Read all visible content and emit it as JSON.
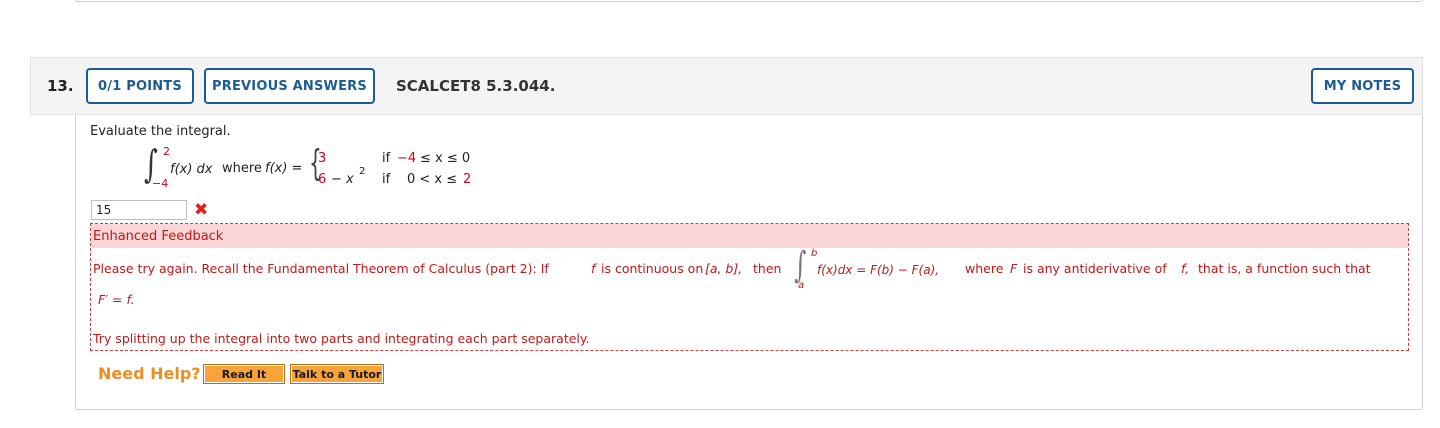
{
  "question": {
    "number": "13.",
    "points_label": "0/1 POINTS",
    "previous_answers_label": "PREVIOUS ANSWERS",
    "reference": "SCALCET8 5.3.044.",
    "my_notes_label": "MY NOTES",
    "prompt": "Evaluate the integral."
  },
  "math": {
    "upper_limit": "2",
    "lower_limit": "−4",
    "integrand": "f(x) dx",
    "where_text": "where",
    "fx_eq": "f(x) =",
    "case1_value": "3",
    "case1_if": "if",
    "case1_cond_lo": "−4",
    "case1_cond_rest": "≤ x ≤ 0",
    "case2_value_a": "6",
    "case2_value_b": "− x",
    "case2_exp": "2",
    "case2_if": "if",
    "case2_cond_lo": "0 < x ≤",
    "case2_cond_hi": "2"
  },
  "answer": {
    "value": "15",
    "status_icon": "x-mark-icon",
    "status_glyph": "✖"
  },
  "feedback": {
    "title": "Enhanced Feedback",
    "line1_part1": "Please try again. Recall the Fundamental Theorem of Calculus (part 2): If",
    "line1_f": "f",
    "line1_part2": "is continuous on",
    "line1_interval": "[a, b],",
    "line1_then": "then",
    "int_upper": "b",
    "int_lower": "a",
    "line1_formula": "f(x)dx = F(b) − F(a),",
    "line1_part3": "where",
    "line1_F": "F",
    "line1_part4": "is any antiderivative of",
    "line1_f2": "f,",
    "line1_part5": "that is, a function such that",
    "line2": "F′ = f.",
    "hint": "Try splitting up the integral into two parts and integrating each part separately."
  },
  "help": {
    "label": "Need Help?",
    "read_it": "Read It",
    "talk_to_tutor": "Talk to a Tutor"
  },
  "colors": {
    "accent_blue": "#1b5d92",
    "error_red": "#c01818",
    "feedback_bg": "#fbd6d6",
    "help_orange": "#f28c1f"
  }
}
